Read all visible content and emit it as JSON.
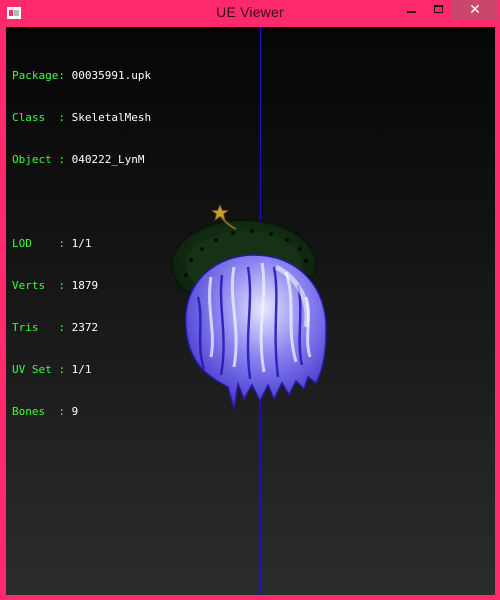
{
  "window": {
    "title": "UE Viewer",
    "controls": {
      "minimize": "",
      "maximize": "",
      "close": "✕"
    },
    "colors": {
      "frame": "#ff2a6d",
      "close_bg": "#c9476a"
    }
  },
  "info": {
    "package": {
      "key": "Package:",
      "value": "00035991.upk"
    },
    "class": {
      "key": "Class  :",
      "value": "SkeletalMesh"
    },
    "object": {
      "key": "Object :",
      "value": "040222_LynM"
    },
    "lod": {
      "key": "LOD    :",
      "value": "1/1"
    },
    "verts": {
      "key": "Verts  :",
      "value": "1879"
    },
    "tris": {
      "key": "Tris   :",
      "value": "2372"
    },
    "uvset": {
      "key": "UV Set :",
      "value": "1/1"
    },
    "bones": {
      "key": "Bones  :",
      "value": "9"
    },
    "colors": {
      "label": "#3aff3a",
      "value": "#ffffff"
    }
  },
  "scene": {
    "mesh": "hair mesh with green hat brim and gold star ornament",
    "axis_color": "#1616c8"
  }
}
